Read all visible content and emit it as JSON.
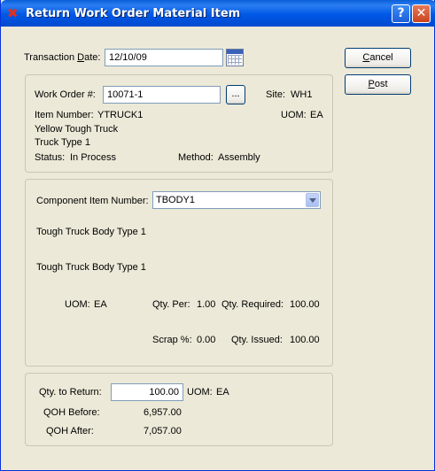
{
  "window": {
    "title": "Return Work Order Material Item",
    "help_label": "?",
    "close_label": "✕",
    "app_icon": "x-logo-icon"
  },
  "transaction": {
    "label": "Transaction Date:",
    "label_pre": "Transaction ",
    "label_ul": "D",
    "label_post": "ate:",
    "value": "12/10/09"
  },
  "buttons": {
    "cancel": {
      "label": "Cancel",
      "pre": "",
      "ul": "C",
      "post": "ancel"
    },
    "post": {
      "label": "Post",
      "pre": "",
      "ul": "P",
      "post": "ost"
    },
    "browse": "..."
  },
  "work_order": {
    "label": "Work Order #:",
    "value": "10071-1",
    "site_label": "Site:",
    "site_value": "WH1",
    "item_number_label": "Item Number:",
    "item_number_value": "YTRUCK1",
    "uom_label": "UOM:",
    "uom_value": "EA",
    "desc1": "Yellow Tough Truck",
    "desc2": "Truck Type 1",
    "status_label": "Status:",
    "status_value": "In Process",
    "method_label": "Method:",
    "method_value": "Assembly"
  },
  "component": {
    "label": "Component Item Number:",
    "selected": "TBODY1",
    "desc1": "Tough Truck Body Type 1",
    "desc2": "Tough Truck Body Type 1",
    "uom_label": "UOM:",
    "uom_value": "EA",
    "qty_per_label": "Qty. Per:",
    "qty_per_value": "1.00",
    "qty_required_label": "Qty. Required:",
    "qty_required_value": "100.00",
    "scrap_label": "Scrap %:",
    "scrap_value": "0.00",
    "qty_issued_label": "Qty. Issued:",
    "qty_issued_value": "100.00"
  },
  "return": {
    "qty_label": "Qty. to Return:",
    "qty_value": "100.00",
    "uom_label": "UOM:",
    "uom_value": "EA",
    "qoh_before_label": "QOH Before:",
    "qoh_before_value": "6,957.00",
    "qoh_after_label": "QOH After:",
    "qoh_after_value": "7,057.00"
  }
}
